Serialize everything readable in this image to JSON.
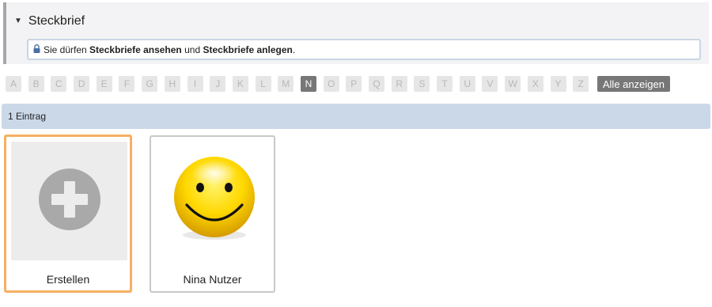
{
  "section": {
    "title": "Steckbrief",
    "permission": {
      "prefix": "Sie dürfen ",
      "strong1": "Steckbriefe ansehen",
      "middle": " und ",
      "strong2": "Steckbriefe anlegen",
      "suffix": "."
    }
  },
  "alphabet": {
    "letters": [
      "A",
      "B",
      "C",
      "D",
      "E",
      "F",
      "G",
      "H",
      "I",
      "J",
      "K",
      "L",
      "M",
      "N",
      "O",
      "P",
      "Q",
      "R",
      "S",
      "T",
      "U",
      "V",
      "W",
      "X",
      "Y",
      "Z"
    ],
    "active": "N",
    "show_all": "Alle anzeigen"
  },
  "results": {
    "count_label": "1 Eintrag"
  },
  "cards": {
    "create": {
      "label": "Erstellen",
      "icon": "plus-circle-icon"
    },
    "person": {
      "label": "Nina Nutzer",
      "icon": "smiley-avatar"
    }
  },
  "colors": {
    "accent_orange": "#f5b062",
    "active_letter": "#777777",
    "count_bar": "#cbd8e8"
  }
}
